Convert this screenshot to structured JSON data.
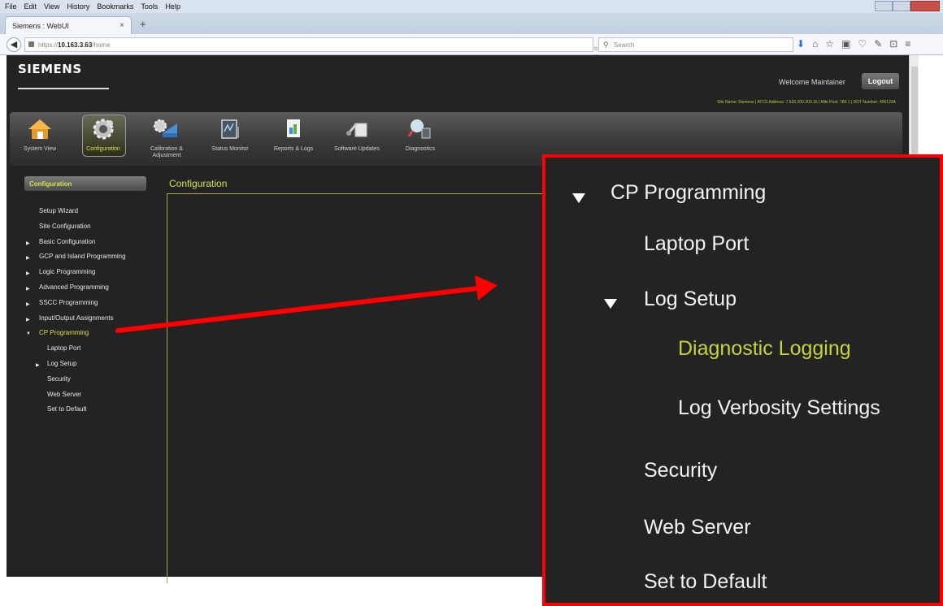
{
  "browser": {
    "menu": [
      "File",
      "Edit",
      "View",
      "History",
      "Bookmarks",
      "Tools",
      "Help"
    ],
    "tab_title": "Siemens : WebUI",
    "tab_close": "×",
    "new_tab": "+",
    "url_prefix": "https://",
    "url_host": "10.163.3.63",
    "url_path": "/home",
    "search_placeholder": "Search",
    "reload": "▿ C"
  },
  "header": {
    "logo": "SIEMENS",
    "welcome": "Welcome Maintainer",
    "logout": "Logout",
    "site_info": "Site Name: Siemens | ATCS Address: 7.620.200.200.16 | Mile Post: 789.1 | DOT Number: 456123A"
  },
  "toolbar": [
    {
      "name": "system-view",
      "label": "System View"
    },
    {
      "name": "configuration",
      "label": "Configuration"
    },
    {
      "name": "calibration",
      "label": "Calibration & Adjustment"
    },
    {
      "name": "status-monitor",
      "label": "Status Monitor"
    },
    {
      "name": "reports-logs",
      "label": "Reports & Logs"
    },
    {
      "name": "software-updates",
      "label": "Software Updates"
    },
    {
      "name": "diagnostics",
      "label": "Diagnostics"
    }
  ],
  "sidebar": {
    "header": "Configuration",
    "items": [
      {
        "label": "Setup Wizard",
        "arrow": "",
        "level": 0
      },
      {
        "label": "Site Configuration",
        "arrow": "",
        "level": 0
      },
      {
        "label": "Basic Configuration",
        "arrow": "▶",
        "level": 0
      },
      {
        "label": "GCP and Island Programming",
        "arrow": "▶",
        "level": 0
      },
      {
        "label": "Logic Programming",
        "arrow": "▶",
        "level": 0
      },
      {
        "label": "Advanced Programming",
        "arrow": "▶",
        "level": 0
      },
      {
        "label": "SSCC Programming",
        "arrow": "▶",
        "level": 0
      },
      {
        "label": "Input/Output Assignments",
        "arrow": "▶",
        "level": 0
      },
      {
        "label": "CP Programming",
        "arrow": "▼",
        "level": 0
      },
      {
        "label": "Laptop Port",
        "arrow": "",
        "level": 1
      },
      {
        "label": "Log Setup",
        "arrow": "▶",
        "level": 1
      },
      {
        "label": "Security",
        "arrow": "",
        "level": 1
      },
      {
        "label": "Web Server",
        "arrow": "",
        "level": 1
      },
      {
        "label": "Set to Default",
        "arrow": "",
        "level": 1
      }
    ]
  },
  "content": {
    "title": "Configuration"
  },
  "zoom": {
    "cp_programming": "CP Programming",
    "laptop_port": "Laptop Port",
    "log_setup": "Log Setup",
    "diagnostic_logging": "Diagnostic Logging",
    "log_verbosity": "Log Verbosity Settings",
    "security": "Security",
    "web_server": "Web Server",
    "set_to_default": "Set to Default"
  },
  "colors": {
    "accent": "#d8e04a",
    "background": "#232323",
    "callout_border": "#ff0000"
  }
}
